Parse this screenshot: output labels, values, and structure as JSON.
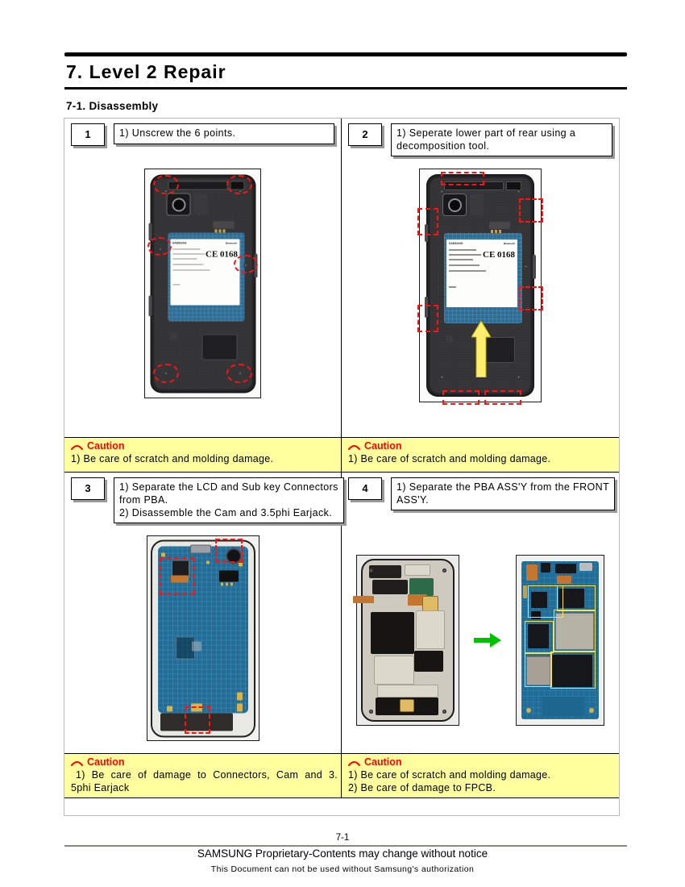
{
  "document": {
    "chapter_title": "7. Level 2 Repair",
    "section_title": "7-1. Disassembly",
    "page_number": "7-1",
    "footer_line1": "SAMSUNG Proprietary-Contents may change without notice",
    "footer_line2": "This Document can not be used without Samsung's authorization"
  },
  "steps": [
    {
      "number": "1",
      "instructions": [
        "1) Unscrew the 6 points."
      ],
      "photo": {
        "alt": "Rear of phone with battery cover removed, six screw locations circled in red dashed circles",
        "label_texts": {
          "brand": "SAMSUNG",
          "bluetooth": "Bluetooth",
          "ce_mark": "CE 0168"
        },
        "annotation_type": "red-dashed-circles",
        "annotation_count": 6
      }
    },
    {
      "number": "2",
      "instructions": [
        "1) Seperate lower part of rear using a",
        "decomposition tool."
      ],
      "photo": {
        "alt": "Rear of phone with red dashed rectangles marking clip positions and a yellow upward arrow",
        "label_texts": {
          "brand": "SAMSUNG",
          "bluetooth": "Bluetooth",
          "ce_mark": "CE 0168"
        },
        "annotation_type": "red-dashed-rectangles",
        "annotation_count": 7,
        "arrow": "yellow-up-arrow"
      }
    },
    {
      "number": "3",
      "instructions": [
        "1) Separate the LCD and Sub key Connectors",
        "from PBA.",
        "2) Disassemble the Cam and 3.5phi Earjack."
      ],
      "photo": {
        "alt": "Blue PBA board mounted in front assembly with red dashed boxes on camera, earjack and bottom connector",
        "annotation_type": "red-dashed-rectangles",
        "annotation_count": 3
      }
    },
    {
      "number": "4",
      "instructions": [
        "1) Separate the PBA ASS'Y from the FRONT",
        "ASS'Y."
      ],
      "photo": {
        "alt": "FRONT ASS'Y on the left, green arrow, PBA ASS'Y on the right with yellow shield outlines",
        "arrow": "green-right-arrow",
        "annotation_type": "yellow-outline-boxes",
        "annotation_count": 6
      }
    }
  ],
  "cautions": [
    {
      "icon": "red-arc-icon",
      "title": "Caution",
      "lines": [
        "1) Be care of scratch and molding damage."
      ]
    },
    {
      "icon": "red-arc-icon",
      "title": "Caution",
      "lines": [
        "1) Be care of scratch and molding damage."
      ]
    },
    {
      "icon": "red-arc-icon",
      "title": "Caution",
      "lines": [
        "1) Be care of damage to Connectors, Cam and 3.",
        "5phi Earjack"
      ]
    },
    {
      "icon": "red-arc-icon",
      "title": "Caution",
      "lines": [
        "1) Be care of scratch and molding damage.",
        "2) Be care of damage to FPCB."
      ]
    }
  ],
  "colors": {
    "caution_background": "#ffff9e",
    "caution_text": "#ff0000",
    "annotation_red": "#ff1111",
    "annotation_yellow": "#ffe14d",
    "annotation_green": "#00c000",
    "board_blue": "#1f6d99"
  }
}
